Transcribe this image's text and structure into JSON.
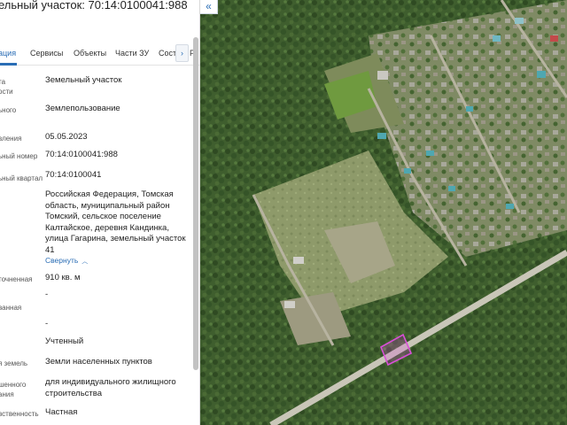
{
  "header": {
    "title": "ельный участок: 70:14:0100041:988"
  },
  "tabs": [
    {
      "label": "ация"
    },
    {
      "label": "Сервисы"
    },
    {
      "label": "Объекты"
    },
    {
      "label": "Части ЗУ"
    },
    {
      "label": "Соста"
    },
    {
      "label": "Р"
    }
  ],
  "tabs_arrow": "›",
  "collapse_icon": "«",
  "fields": [
    {
      "label": "та",
      "label2": "ости",
      "value": "Земельный участок"
    },
    {
      "label": "ьного",
      "value": "Землепользование"
    },
    {
      "label": "вления",
      "value": "05.05.2023"
    },
    {
      "label": "ьный номер",
      "value": "70:14:0100041:988"
    },
    {
      "label": "ьный квартал",
      "value": "70:14:0100041"
    },
    {
      "label": "",
      "value": "Российская Федерация, Томская область, муниципальный район Томский, сельское поселение Калтайское, деревня Кандинка, улица Гагарина, земельный участок 41"
    },
    {
      "label": "точненная",
      "value": "910 кв. м"
    },
    {
      "label": "ванная",
      "value": "-"
    },
    {
      "label": "",
      "value": "-"
    },
    {
      "label": "",
      "value": "Учтенный"
    },
    {
      "label": "я земель",
      "value": "Земли населенных пунктов"
    },
    {
      "label": "шенного",
      "label2": "ания",
      "value": "для индивидуального жилищного строительства"
    },
    {
      "label": "вственность",
      "value": "Частная"
    }
  ],
  "collapse_link": "Свернуть",
  "colors": {
    "accent": "#2a6db5",
    "parcel_outline": "#d94fd8"
  }
}
